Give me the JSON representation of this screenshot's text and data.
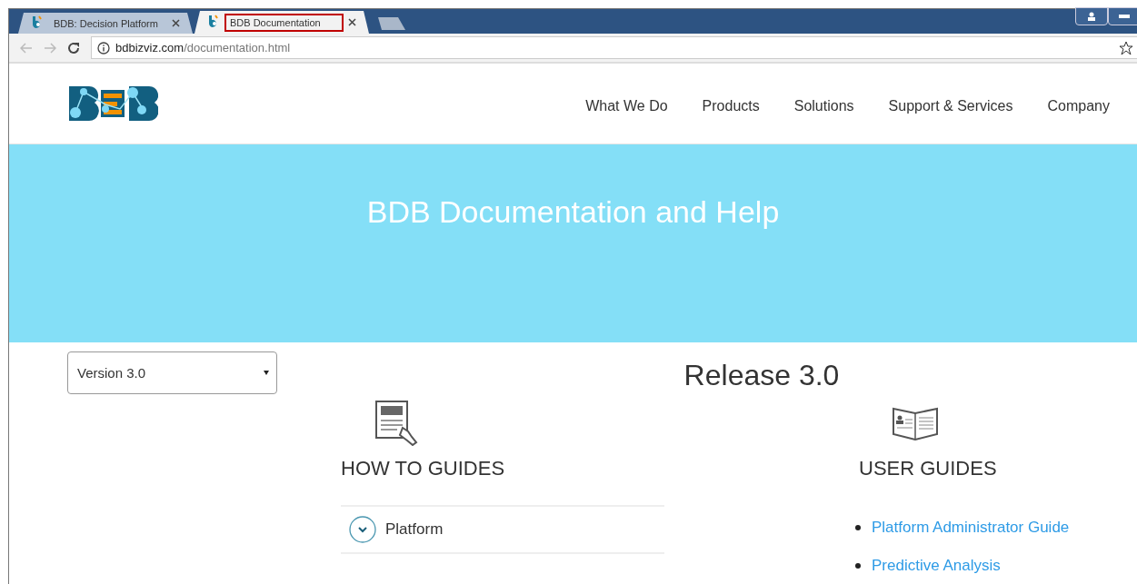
{
  "browser": {
    "tabs": [
      {
        "title": "BDB: Decision Platform",
        "selected": false,
        "highlighted": false
      },
      {
        "title": "BDB Documentation",
        "selected": true,
        "highlighted": true
      }
    ],
    "address": {
      "domain": "bdbizviz.com",
      "path": "/documentation.html"
    }
  },
  "header": {
    "nav": [
      "What We Do",
      "Products",
      "Solutions",
      "Support & Services",
      "Company"
    ]
  },
  "hero": {
    "title": "BDB Documentation and Help"
  },
  "sidebar": {
    "version_select": {
      "value": "Version 3.0"
    }
  },
  "content": {
    "title": "Release 3.0",
    "how_to_guides": {
      "heading": "HOW TO GUIDES",
      "items": [
        {
          "label": "Platform",
          "expanded": false
        }
      ]
    },
    "user_guides": {
      "heading": "USER GUIDES",
      "links": [
        "Platform Administrator Guide",
        "Predictive Analysis"
      ]
    }
  }
}
